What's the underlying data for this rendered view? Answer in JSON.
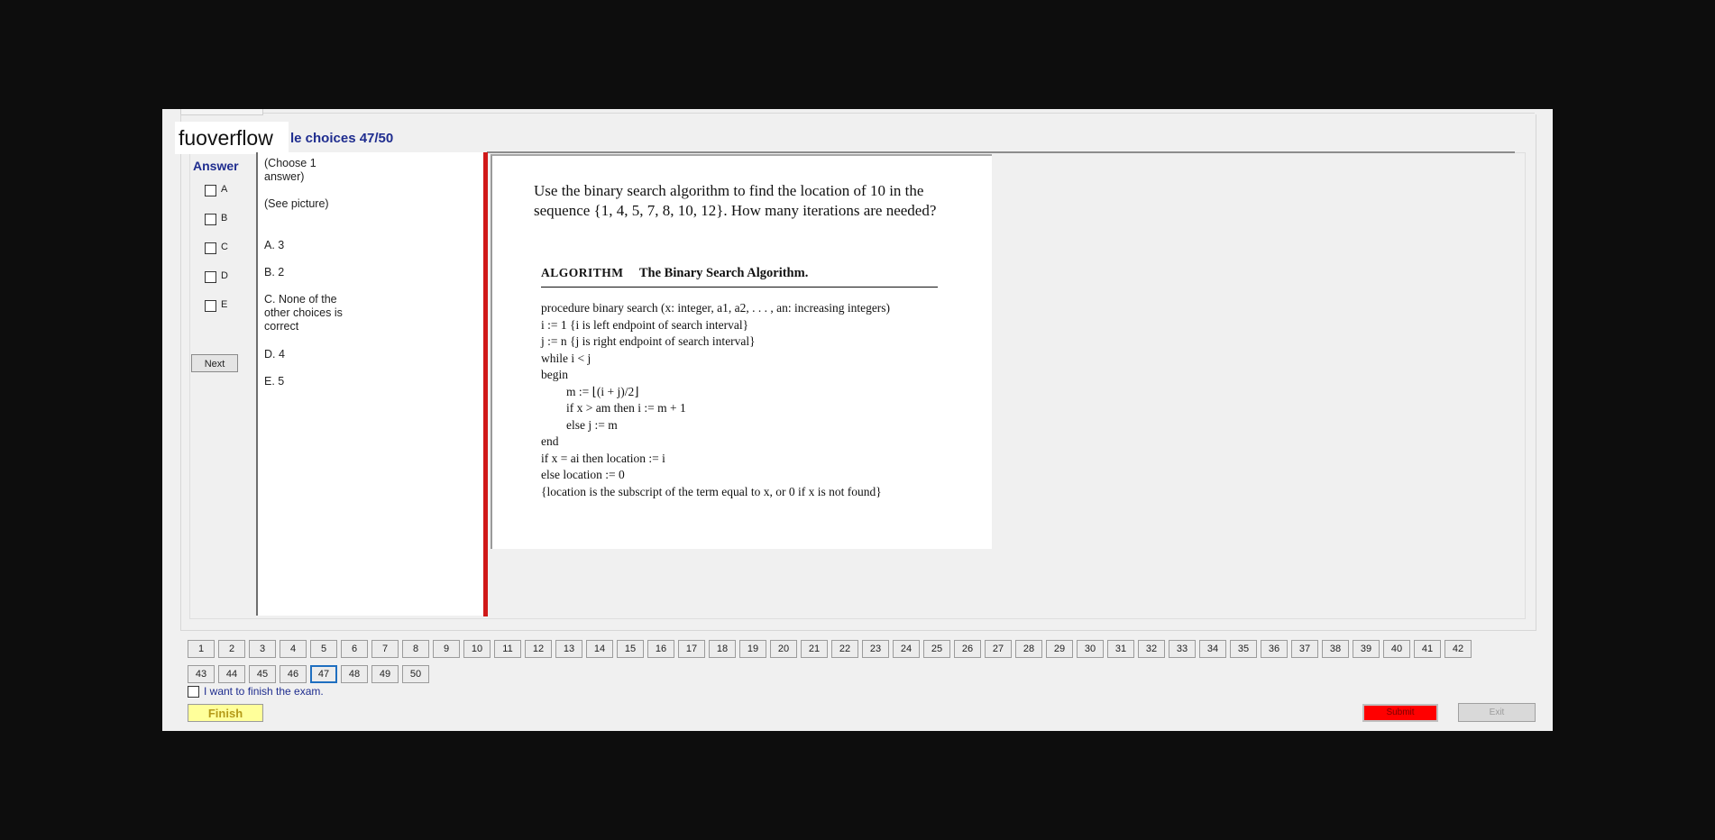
{
  "logo": "fuoverflow",
  "header": {
    "title": "le choices 47/50"
  },
  "answer": {
    "label": "Answer",
    "options": [
      "A",
      "B",
      "C",
      "D",
      "E"
    ],
    "next_label": "Next"
  },
  "question_text": {
    "choose": "(Choose 1 answer)",
    "see_picture": "(See picture)",
    "choices": [
      "A. 3",
      "B. 2",
      "C. None of the other choices is correct",
      "D. 4",
      "E. 5"
    ]
  },
  "picture": {
    "question": "Use the binary search algorithm to find the location of 10 in the sequence {1, 4, 5, 7, 8, 10, 12}. How many iterations are needed?",
    "algo_keyword": "ALGORITHM",
    "algo_title": "The Binary Search Algorithm.",
    "lines": [
      "procedure binary search (x: integer, a1, a2, . . . , an: increasing integers)",
      "i := 1   {i is left endpoint of search interval}",
      "j := n   {j is right endpoint of search interval}",
      "while i < j",
      "begin",
      "m := ⌊(i + j)/2⌋",
      "if x > am then i := m + 1",
      "else j := m",
      "end",
      "if x = ai then location := i",
      "else location := 0",
      "{location is the subscript of the term equal to x, or 0 if x is not found}"
    ]
  },
  "nav": {
    "numbers": [
      "1",
      "2",
      "3",
      "4",
      "5",
      "6",
      "7",
      "8",
      "9",
      "10",
      "11",
      "12",
      "13",
      "14",
      "15",
      "16",
      "17",
      "18",
      "19",
      "20",
      "21",
      "22",
      "23",
      "24",
      "25",
      "26",
      "27",
      "28",
      "29",
      "30",
      "31",
      "32",
      "33",
      "34",
      "35",
      "36",
      "37",
      "38",
      "39",
      "40",
      "41",
      "42",
      "43",
      "44",
      "45",
      "46",
      "47",
      "48",
      "49",
      "50"
    ],
    "current": "47"
  },
  "footer": {
    "finish_check_label": "I want to finish the exam.",
    "finish_label": "Finish",
    "submit_label": "Submit",
    "exit_label": "Exit"
  },
  "colors": {
    "accent": "#1f2d8f",
    "red_bar": "#d01818",
    "submit": "#ff0000",
    "finish": "#ffff9a",
    "current_border": "#1f6fc0"
  }
}
